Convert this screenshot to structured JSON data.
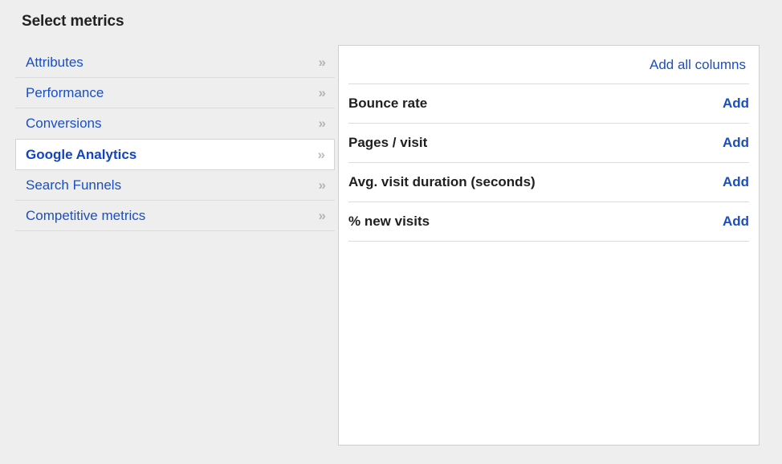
{
  "page": {
    "title": "Select metrics",
    "background_color": "#eeeeee",
    "link_color": "#1a4fc4",
    "text_color": "#1f1f1f"
  },
  "categories": {
    "selected_index": 3,
    "chevron_icon": "»",
    "items": [
      {
        "label": "Attributes"
      },
      {
        "label": "Performance"
      },
      {
        "label": "Conversions"
      },
      {
        "label": "Google Analytics"
      },
      {
        "label": "Search Funnels"
      },
      {
        "label": "Competitive metrics"
      }
    ]
  },
  "metrics_panel": {
    "add_all_label": "Add all columns",
    "add_label": "Add",
    "metrics": [
      {
        "name": "Bounce rate",
        "action": "Add"
      },
      {
        "name": "Pages / visit",
        "action": "Add"
      },
      {
        "name": "Avg. visit duration (seconds)",
        "action": "Add"
      },
      {
        "name": "% new visits",
        "action": "Add"
      }
    ]
  }
}
